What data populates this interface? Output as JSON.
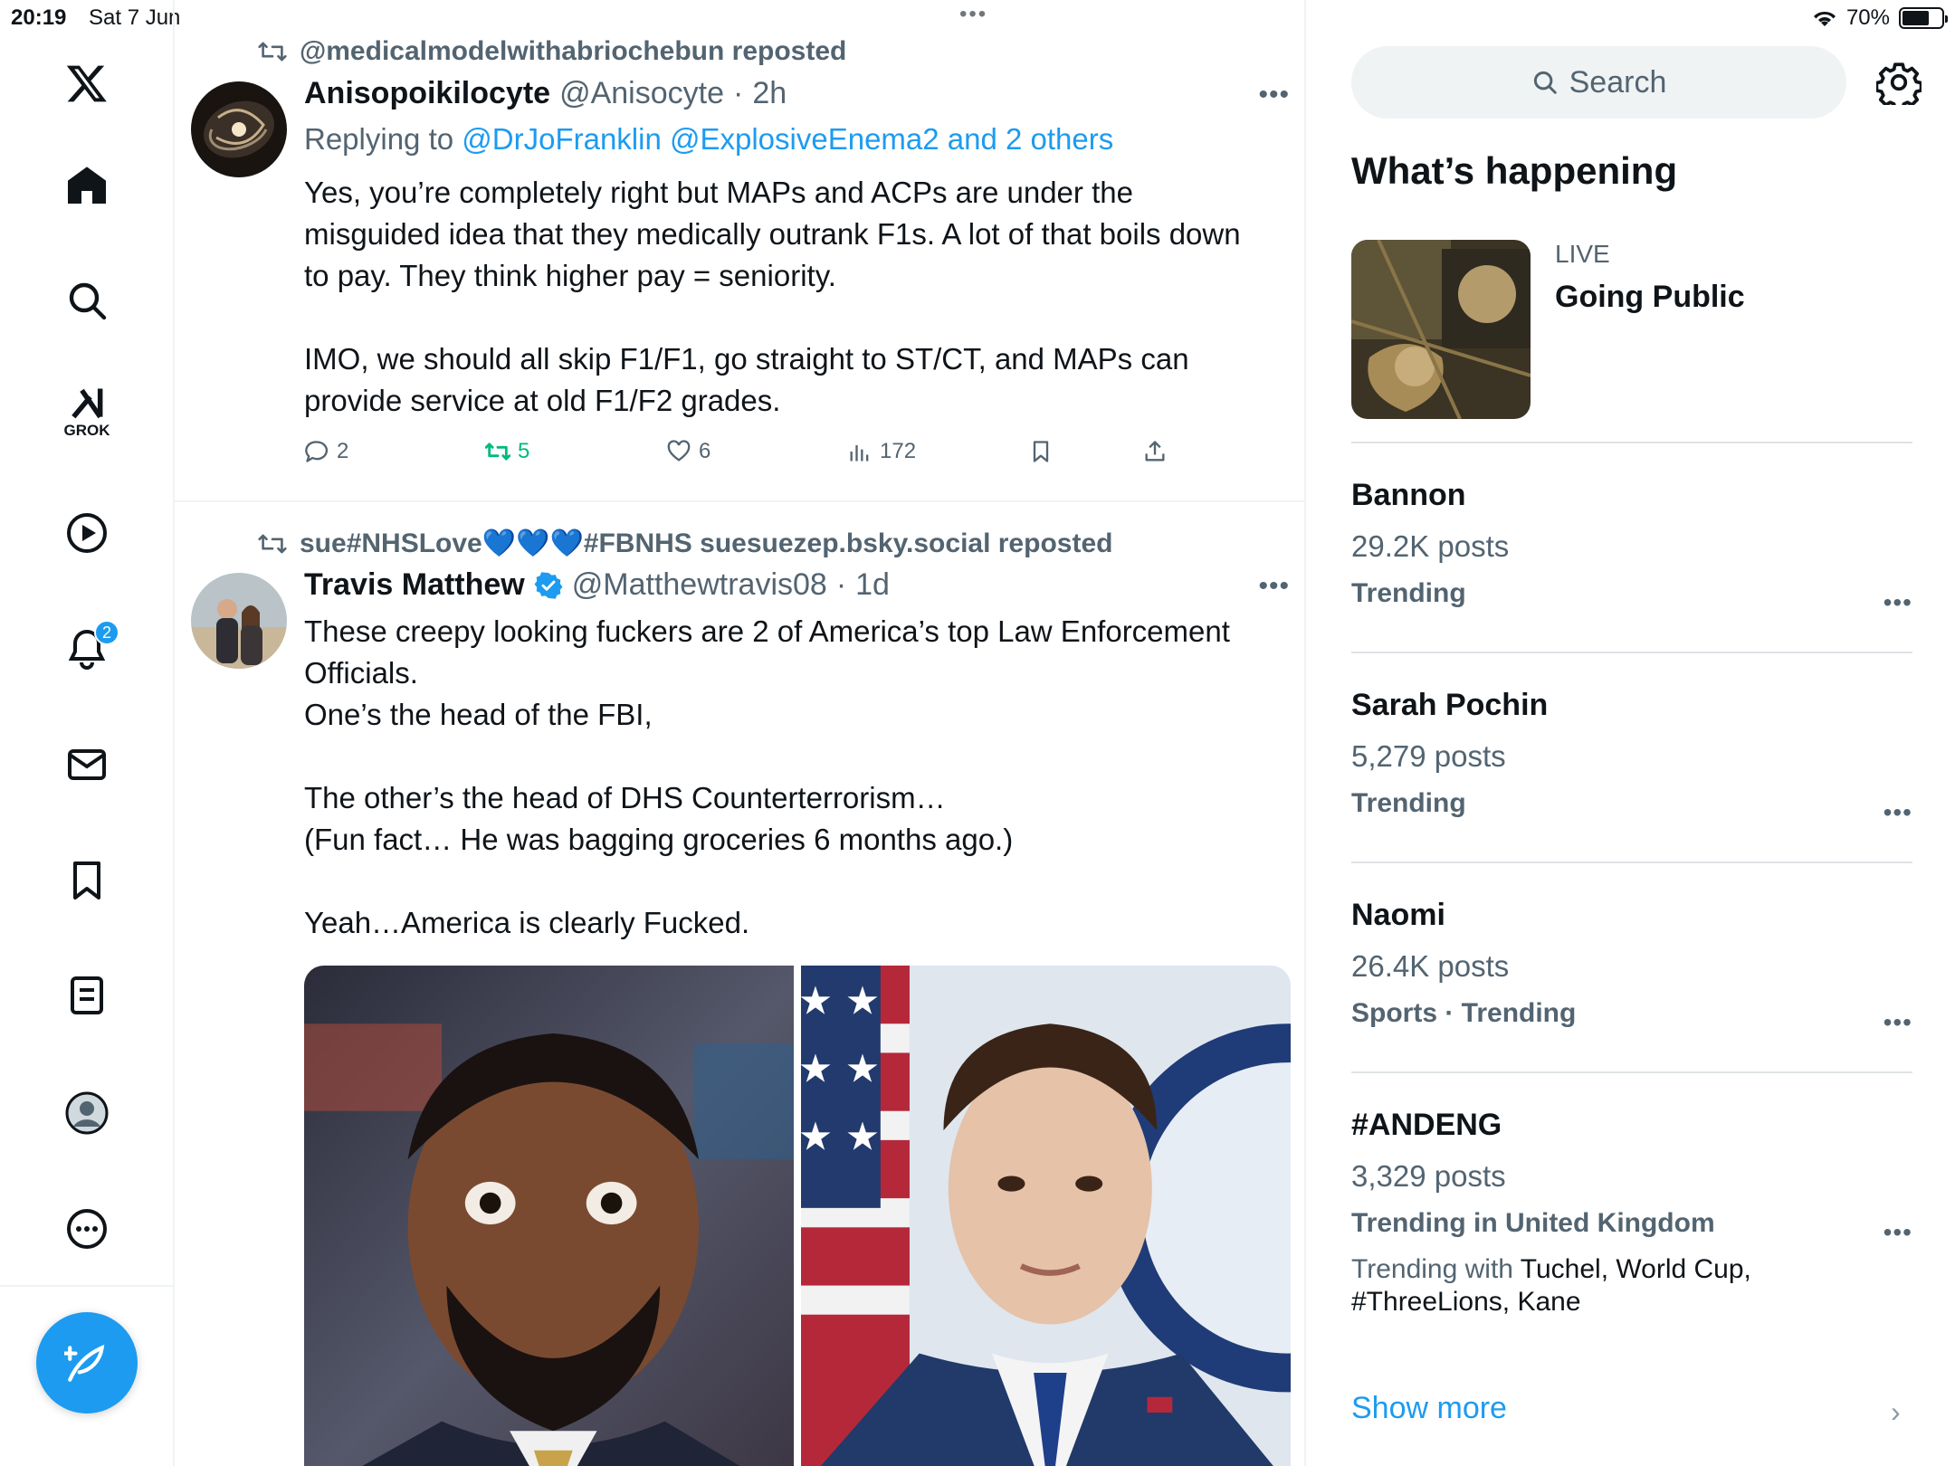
{
  "status_bar": {
    "time": "20:19",
    "date": "Sat 7 Jun",
    "battery": "70%",
    "battery_level": 0.7
  },
  "nav": {
    "grok_label": "GROK",
    "notifications_badge": "2"
  },
  "tweets": [
    {
      "repost_by": "@medicalmodelwithabriochebun reposted",
      "name": "Anisopoikilocyte",
      "handle": "@Anisocyte",
      "time": "2h",
      "replying_prefix": "Replying to ",
      "replying_to": "@DrJoFranklin @ExplosiveEnema2 and 2 others",
      "body": [
        "Yes, you’re completely right but MAPs and ACPs are under the",
        "misguided idea that they medically outrank F1s. A lot of that boils down",
        "to pay. They think higher pay = seniority.",
        "",
        "IMO, we should all skip F1/F1, go straight to ST/CT, and MAPs can",
        "provide service at old F1/F2 grades."
      ],
      "replies": "2",
      "reposts": "5",
      "likes": "6",
      "views": "172"
    },
    {
      "repost_by": "sue#NHSLove💙💙💙#FBNHS suesuezep.bsky.social reposted",
      "name": "Travis Matthew",
      "handle": "@Matthewtravis08",
      "time": "1d",
      "body": [
        "These creepy looking fuckers are 2 of America’s top Law Enforcement",
        "Officials.",
        "One’s the head of the FBI,",
        "",
        "The other’s the head of DHS Counterterrorism…",
        "(Fun fact… He was bagging groceries 6 months ago.)",
        "",
        "Yeah…America is clearly Fucked."
      ]
    }
  ],
  "sidebar": {
    "search_placeholder": "Search",
    "whats_happening": "What’s happening",
    "live": {
      "label": "LIVE",
      "title": "Going Public"
    },
    "trends": [
      {
        "name": "Bannon",
        "count": "29.2K posts",
        "category": "Trending"
      },
      {
        "name": "Sarah Pochin",
        "count": "5,279 posts",
        "category": "Trending"
      },
      {
        "name": "Naomi",
        "count": "26.4K posts",
        "category": "Sports · Trending"
      },
      {
        "name": "#ANDENG",
        "count": "3,329 posts",
        "category": "Trending in United Kingdom",
        "with_prefix": "Trending with ",
        "with_line1": "Tuchel, World Cup,",
        "with_line2": "#ThreeLions, Kane"
      }
    ],
    "show_more": "Show more"
  },
  "colors": {
    "accent": "#1d9bf0",
    "repost_green": "#00ba7c",
    "secondary_text": "#536471"
  }
}
